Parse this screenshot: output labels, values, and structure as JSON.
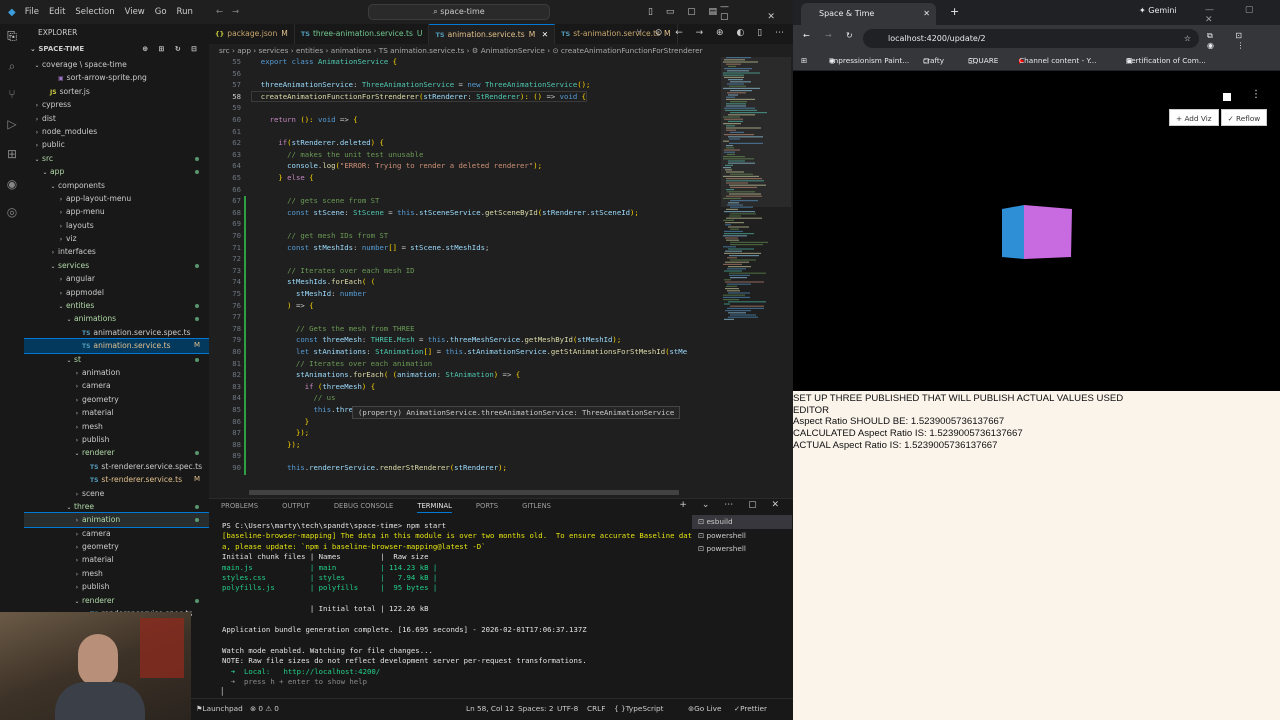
{
  "titlebar": {
    "menus": [
      "File",
      "Edit",
      "Selection",
      "View",
      "Go",
      "Run"
    ],
    "search": "space-time"
  },
  "explorer": {
    "header": "EXPLORER",
    "project": "SPACE-TIME",
    "items": [
      {
        "label": "coverage \\ space-time",
        "depth": 1,
        "kind": "folder",
        "open": true,
        "git": ""
      },
      {
        "label": "sort-arrow-sprite.png",
        "depth": 3,
        "kind": "file",
        "git": ""
      },
      {
        "label": "sorter.js",
        "depth": 2,
        "kind": "js",
        "git": ""
      },
      {
        "label": "cypress",
        "depth": 1,
        "kind": "folder",
        "open": false,
        "git": ""
      },
      {
        "label": "dist",
        "depth": 1,
        "kind": "folder",
        "open": false,
        "git": ""
      },
      {
        "label": "node_modules",
        "depth": 1,
        "kind": "folder",
        "open": false,
        "git": ""
      },
      {
        "label": "public",
        "depth": 1,
        "kind": "folder",
        "open": false,
        "git": ""
      },
      {
        "label": "src",
        "depth": 1,
        "kind": "folder",
        "open": true,
        "git": "dot"
      },
      {
        "label": "app",
        "depth": 2,
        "kind": "folder",
        "open": true,
        "git": "dot"
      },
      {
        "label": "components",
        "depth": 3,
        "kind": "folder",
        "open": true,
        "git": ""
      },
      {
        "label": "app-layout-menu",
        "depth": 4,
        "kind": "folder",
        "open": false,
        "git": ""
      },
      {
        "label": "app-menu",
        "depth": 4,
        "kind": "folder",
        "open": false,
        "git": ""
      },
      {
        "label": "layouts",
        "depth": 4,
        "kind": "folder",
        "open": false,
        "git": ""
      },
      {
        "label": "viz",
        "depth": 4,
        "kind": "folder",
        "open": false,
        "git": ""
      },
      {
        "label": "interfaces",
        "depth": 3,
        "kind": "folder",
        "open": false,
        "git": ""
      },
      {
        "label": "services",
        "depth": 3,
        "kind": "folder",
        "open": true,
        "git": "dot"
      },
      {
        "label": "angular",
        "depth": 4,
        "kind": "folder",
        "open": false,
        "git": ""
      },
      {
        "label": "appmodel",
        "depth": 4,
        "kind": "folder",
        "open": false,
        "git": ""
      },
      {
        "label": "entities",
        "depth": 4,
        "kind": "folder",
        "open": true,
        "git": "dot"
      },
      {
        "label": "animations",
        "depth": 5,
        "kind": "folder",
        "open": true,
        "git": "dot"
      },
      {
        "label": "animation.service.spec.ts",
        "depth": 6,
        "kind": "ts",
        "git": ""
      },
      {
        "label": "animation.service.ts",
        "depth": 6,
        "kind": "ts",
        "git": "M",
        "sel": true
      },
      {
        "label": "st",
        "depth": 5,
        "kind": "folder",
        "open": true,
        "git": "dot"
      },
      {
        "label": "animation",
        "depth": 6,
        "kind": "folder",
        "open": false,
        "git": ""
      },
      {
        "label": "camera",
        "depth": 6,
        "kind": "folder",
        "open": false,
        "git": ""
      },
      {
        "label": "geometry",
        "depth": 6,
        "kind": "folder",
        "open": false,
        "git": ""
      },
      {
        "label": "material",
        "depth": 6,
        "kind": "folder",
        "open": false,
        "git": ""
      },
      {
        "label": "mesh",
        "depth": 6,
        "kind": "folder",
        "open": false,
        "git": ""
      },
      {
        "label": "publish",
        "depth": 6,
        "kind": "folder",
        "open": false,
        "git": ""
      },
      {
        "label": "renderer",
        "depth": 6,
        "kind": "folder",
        "open": true,
        "git": "dot"
      },
      {
        "label": "st-renderer.service.spec.ts",
        "depth": 7,
        "kind": "ts",
        "git": ""
      },
      {
        "label": "st-renderer.service.ts",
        "depth": 7,
        "kind": "ts",
        "git": "M"
      },
      {
        "label": "scene",
        "depth": 6,
        "kind": "folder",
        "open": false,
        "git": ""
      },
      {
        "label": "three",
        "depth": 5,
        "kind": "folder",
        "open": true,
        "git": "dot"
      },
      {
        "label": "animation",
        "depth": 6,
        "kind": "folder",
        "open": false,
        "git": "dot",
        "hov": true
      },
      {
        "label": "camera",
        "depth": 6,
        "kind": "folder",
        "open": false,
        "git": ""
      },
      {
        "label": "geometry",
        "depth": 6,
        "kind": "folder",
        "open": false,
        "git": ""
      },
      {
        "label": "material",
        "depth": 6,
        "kind": "folder",
        "open": false,
        "git": ""
      },
      {
        "label": "mesh",
        "depth": 6,
        "kind": "folder",
        "open": false,
        "git": ""
      },
      {
        "label": "publish",
        "depth": 6,
        "kind": "folder",
        "open": false,
        "git": ""
      },
      {
        "label": "renderer",
        "depth": 6,
        "kind": "folder",
        "open": true,
        "git": "dot"
      },
      {
        "label": "renderer.service.spec.ts",
        "depth": 7,
        "kind": "ts",
        "git": ""
      }
    ]
  },
  "tabs": [
    {
      "label": "package.json",
      "mark": "M",
      "icon": "{}"
    },
    {
      "label": "three-animation.service.ts",
      "mark": "U",
      "icon": "TS"
    },
    {
      "label": "animation.service.ts",
      "mark": "M",
      "icon": "TS",
      "active": true
    },
    {
      "label": "st-animation.service.ts",
      "mark": "M",
      "icon": "TS"
    }
  ],
  "breadcrumb": "src › app › services › entities › animations › TS animation.service.ts › ⚙ AnimationService › ⊙ createAnimationFunctionForStrenderer",
  "code": {
    "lines": [
      {
        "n": "55",
        "t": "  export class AnimationService {"
      },
      {
        "n": "56",
        "t": ""
      },
      {
        "n": "57",
        "t": "  threeAnimationService: ThreeAnimationService = new ThreeAnimationService();"
      },
      {
        "n": "58",
        "t": "  createAnimationFunctionForStrenderer(stRenderer: StRenderer): () => void {"
      },
      {
        "n": "59",
        "t": ""
      },
      {
        "n": "60",
        "t": "    return (): void => {"
      },
      {
        "n": "61",
        "t": ""
      },
      {
        "n": "62",
        "t": "      if(stRenderer.deleted) {"
      },
      {
        "n": "63",
        "t": "        // makes the unit test unusable"
      },
      {
        "n": "64",
        "t": "        console.log(\"ERROR: Trying to render a deleted renderer\");"
      },
      {
        "n": "65",
        "t": "      } else {"
      },
      {
        "n": "66",
        "t": ""
      },
      {
        "n": "67",
        "t": "        // gets scene from ST"
      },
      {
        "n": "68",
        "t": "        const stScene: StScene = this.stSceneService.getSceneById(stRenderer.stSceneId);"
      },
      {
        "n": "69",
        "t": ""
      },
      {
        "n": "70",
        "t": "        // get mesh IDs from ST"
      },
      {
        "n": "71",
        "t": "        const stMeshIds: number[] = stScene.stMeshIds;"
      },
      {
        "n": "72",
        "t": ""
      },
      {
        "n": "73",
        "t": "        // Iterates over each mesh ID"
      },
      {
        "n": "74",
        "t": "        stMeshIds.forEach( ("
      },
      {
        "n": "75",
        "t": "          stMeshId: number"
      },
      {
        "n": "76",
        "t": "        ) => {"
      },
      {
        "n": "77",
        "t": ""
      },
      {
        "n": "78",
        "t": "          // Gets the mesh from THREE"
      },
      {
        "n": "79",
        "t": "          const threeMesh: THREE.Mesh = this.threeMeshService.getMeshById(stMeshId);"
      },
      {
        "n": "80",
        "t": "          let stAnimations: StAnimation[] = this.stAnimationService.getStAnimationsForStMeshId(stMe"
      },
      {
        "n": "81",
        "t": "          // Iterates over each animation"
      },
      {
        "n": "82",
        "t": "          stAnimations.forEach( (animation: StAnimation) => {"
      },
      {
        "n": "83",
        "t": "            if (threeMesh) {"
      },
      {
        "n": "84",
        "t": "              // us"
      },
      {
        "n": "85",
        "t": "              this.threeAnimationService.updatePropertyForAnimation(threeMesh, animation)"
      },
      {
        "n": "86",
        "t": "            }"
      },
      {
        "n": "87",
        "t": "          });"
      },
      {
        "n": "88",
        "t": "        });"
      },
      {
        "n": "89",
        "t": ""
      },
      {
        "n": "90",
        "t": "        this.rendererService.renderStRenderer(stRenderer);"
      }
    ],
    "hover": "(property) AnimationService.threeAnimationService: ThreeAnimationService"
  },
  "panel": {
    "tabs": [
      "PROBLEMS",
      "OUTPUT",
      "DEBUG CONSOLE",
      "TERMINAL",
      "PORTS",
      "GITLENS"
    ],
    "active": "TERMINAL",
    "terminals": [
      "esbuild",
      "powershell",
      "powershell"
    ],
    "lines": [
      {
        "t": "PS C:\\Users\\marty\\tech\\spandt\\space-time> npm start",
        "c": "wh"
      },
      {
        "t": "[baseline-browser-mapping] The data in this module is over two months old.  To ensure accurate Baseline dat",
        "c": "wy"
      },
      {
        "t": "a, please update: `npm i baseline-browser-mapping@latest -D`",
        "c": "wy"
      },
      {
        "t": "Initial chunk files | Names         |  Raw size",
        "c": "wh"
      },
      {
        "t": "main.js             | main          | 114.23 kB |",
        "c": "gr"
      },
      {
        "t": "styles.css          | styles        |   7.94 kB |",
        "c": "gr"
      },
      {
        "t": "polyfills.js        | polyfills     |  95 bytes |",
        "c": "gr"
      },
      {
        "t": "",
        "c": "wh"
      },
      {
        "t": "                    | Initial total | 122.26 kB",
        "c": "wh"
      },
      {
        "t": "",
        "c": "wh"
      },
      {
        "t": "Application bundle generation complete. [16.695 seconds] - 2026-02-01T17:06:37.137Z",
        "c": "wh"
      },
      {
        "t": "",
        "c": "wh"
      },
      {
        "t": "Watch mode enabled. Watching for file changes...",
        "c": "wh"
      },
      {
        "t": "NOTE: Raw file sizes do not reflect development server per-request transformations.",
        "c": "wh"
      },
      {
        "t": "  ➜  Local:   http://localhost:4200/",
        "c": "gr"
      },
      {
        "t": "  ➜  press h + enter to show help",
        "c": "gy"
      }
    ]
  },
  "status": {
    "launch": "Launchpad",
    "problems": "⊗ 0 ⚠ 0",
    "pos": "Ln 58, Col 12",
    "spaces": "Spaces: 2",
    "enc": "UTF-8",
    "eol": "CRLF",
    "lang": "TypeScript",
    "golive": "Go Live",
    "prettier": "Prettier"
  },
  "browser": {
    "tab_title": "Space & Time",
    "url": "localhost:4200/update/2",
    "gemini": "Gemini",
    "bookmarks": [
      "Impressionism Paint...",
      "crafty",
      "SQUARE",
      "Channel content - Y...",
      "Certification of Com..."
    ],
    "buttons": {
      "add": "Add Viz",
      "reflow": "Reflow"
    },
    "info": [
      "SET UP THREE PUBLISHED THAT WILL PUBLISH ACTUAL VALUES USED",
      "EDITOR",
      "Aspect Ratio SHOULD BE: 1.5239005736137667",
      "CALCULATED Aspect Ratio IS: 1.5239005736137667",
      "ACTUAL Aspect Ratio IS: 1.5239005736137667"
    ]
  },
  "colors": {
    "accent": "#0078d4",
    "selection": "#04395e",
    "cube_left": "#2f8fd6",
    "cube_front": "#c96be0"
  }
}
